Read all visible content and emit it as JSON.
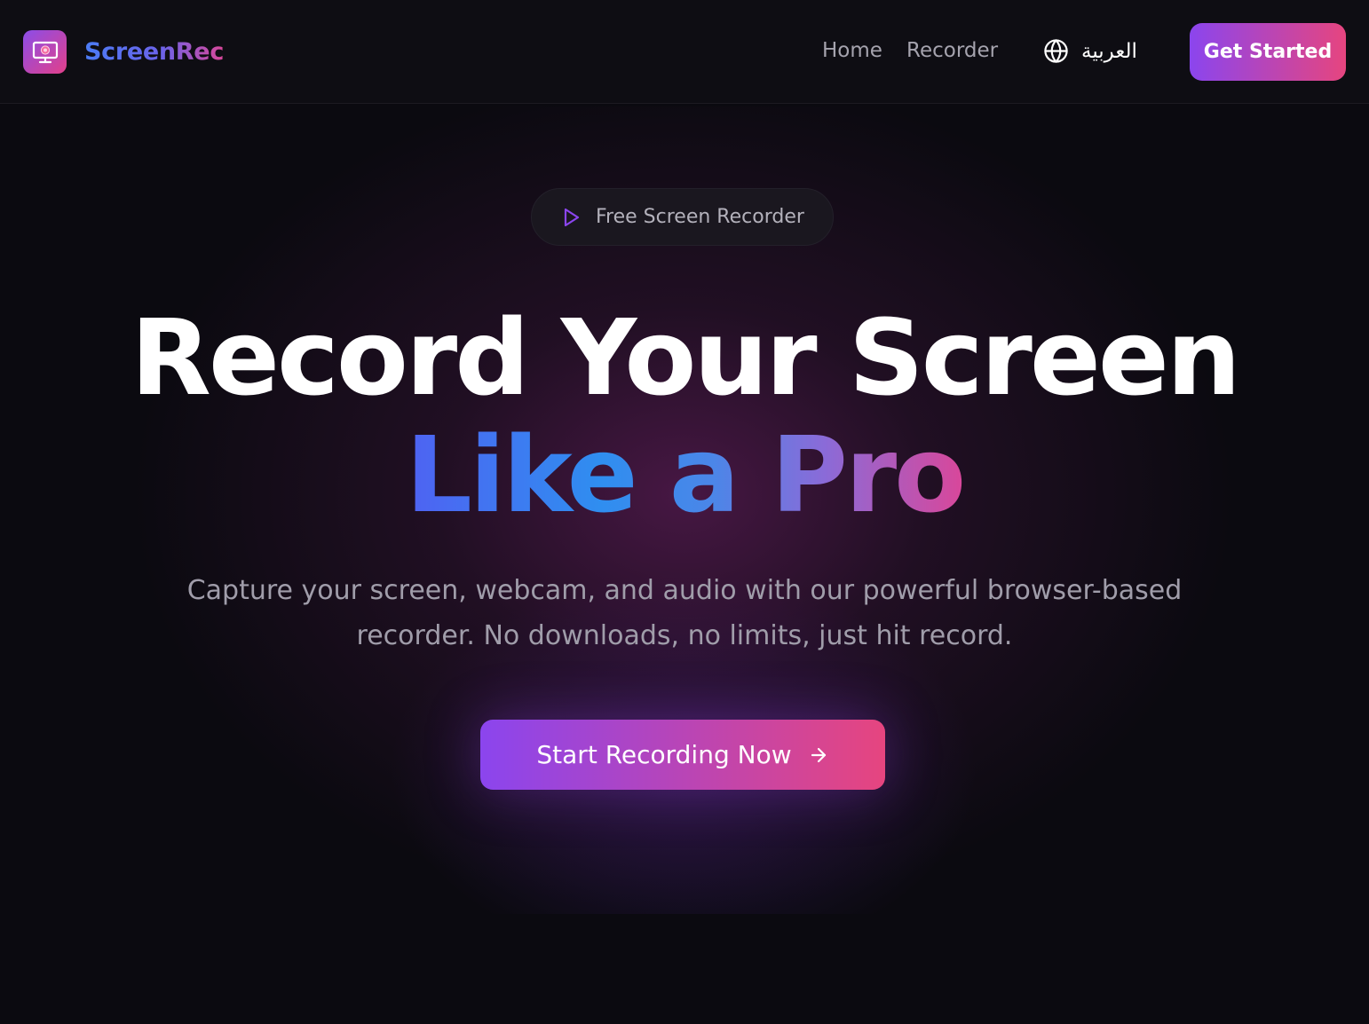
{
  "header": {
    "brand_name": "ScreenRec",
    "nav": {
      "home": "Home",
      "recorder": "Recorder"
    },
    "language_label": "العربية",
    "cta_label": "Get Started"
  },
  "hero": {
    "badge_text": "Free Screen Recorder",
    "title_line1": "Record Your Screen",
    "title_line2": "Like a Pro",
    "subtitle_line1": "Capture your screen, webcam, and audio with our powerful browser-based",
    "subtitle_line2": "recorder. No downloads, no limits, just hit record.",
    "cta_label": "Start Recording Now"
  },
  "icons": {
    "brand": "monitor-record-icon",
    "language": "globe-icon",
    "badge": "play-icon",
    "cta": "arrow-right-icon"
  },
  "colors": {
    "background": "#0b0a10",
    "header_background": "#0e0d13",
    "gradient_start": "#8b45ee",
    "gradient_end": "#e6457f",
    "accent_blue": "#2f8ef0",
    "muted_text": "#a09daa"
  }
}
